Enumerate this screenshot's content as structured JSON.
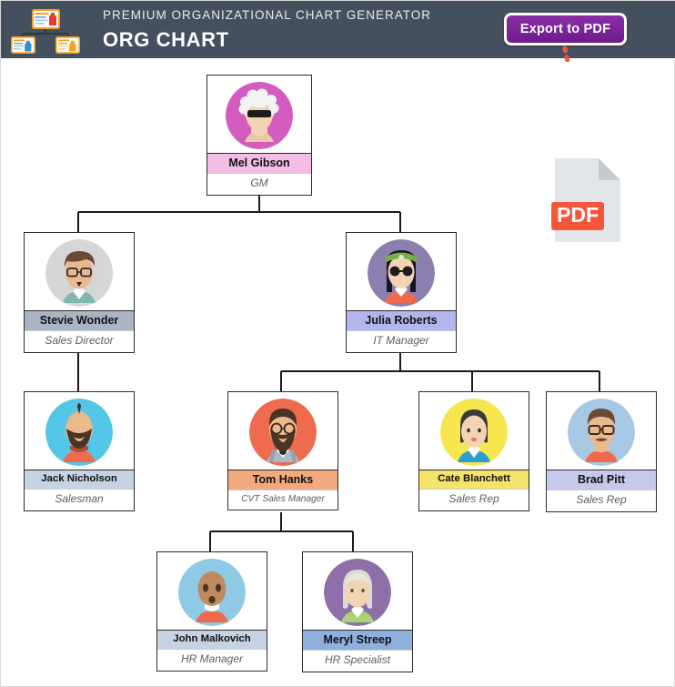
{
  "header": {
    "subtitle": "PREMIUM ORGANIZATIONAL CHART GENERATOR",
    "title": "ORG CHART",
    "export_label": "Export to PDF",
    "background_color": "#44505e",
    "export_button_color": "#7a27a0",
    "logo_icon": "org-chart-logo-icon"
  },
  "pdf": {
    "badge_label": "PDF",
    "badge_color": "#f4563c",
    "arrow_color": "#f4563c",
    "icon": "pdf-document-icon"
  },
  "chart_data": {
    "type": "diagram",
    "title": "ORG CHART",
    "nodes": [
      {
        "id": "mel",
        "name": "Mel Gibson",
        "role": "GM",
        "band_color": "#f3bde4",
        "avatar_bg": "#d45cc0",
        "avatar": "woman-white-curly-hair-sunglasses",
        "level": 0,
        "parent": null
      },
      {
        "id": "stevie",
        "name": "Stevie Wonder",
        "role": "Sales Director",
        "band_color": "#aab4c4",
        "avatar_bg": "#d4d6d8",
        "avatar": "man-brown-hair-glasses",
        "level": 1,
        "parent": "mel"
      },
      {
        "id": "julia",
        "name": "Julia Roberts",
        "role": "IT Manager",
        "band_color": "#b3b6ee",
        "avatar_bg": "#8c7faf",
        "avatar": "woman-black-hair-headband-sunglasses",
        "level": 1,
        "parent": "mel"
      },
      {
        "id": "jack",
        "name": "Jack Nicholson",
        "role": "Salesman",
        "band_color": "#c5d3e2",
        "avatar_bg": "#54c6e8",
        "avatar": "bald-man-beard",
        "level": 2,
        "parent": "stevie"
      },
      {
        "id": "tom",
        "name": "Tom Hanks",
        "role": "CVT Sales Manager",
        "band_color": "#f3a97e",
        "avatar_bg": "#ee6c4d",
        "avatar": "man-beard-glasses-bowtie",
        "level": 2,
        "parent": "julia"
      },
      {
        "id": "cate",
        "name": "Cate Blanchett",
        "role": "Sales Rep",
        "band_color": "#f5e36b",
        "avatar_bg": "#f7e64e",
        "avatar": "woman-black-bob-blue-shirt",
        "level": 2,
        "parent": "julia"
      },
      {
        "id": "brad",
        "name": "Brad Pitt",
        "role": "Sales Rep",
        "band_color": "#c6c9ec",
        "avatar_bg": "#a7c8e5",
        "avatar": "man-moustache-glasses",
        "level": 2,
        "parent": "julia"
      },
      {
        "id": "john",
        "name": "John Malkovich",
        "role": "HR Manager",
        "band_color": "#c5d3e2",
        "avatar_bg": "#8ecae6",
        "avatar": "bald-man-dark-skin",
        "level": 3,
        "parent": "tom"
      },
      {
        "id": "meryl",
        "name": "Meryl Streep",
        "role": "HR Specialist",
        "band_color": "#8fb0de",
        "avatar_bg": "#8e6fa8",
        "avatar": "woman-grey-hair-green-shirt",
        "level": 3,
        "parent": "tom"
      }
    ],
    "edges": [
      {
        "from": "mel",
        "to": "stevie"
      },
      {
        "from": "mel",
        "to": "julia"
      },
      {
        "from": "stevie",
        "to": "jack"
      },
      {
        "from": "julia",
        "to": "tom"
      },
      {
        "from": "julia",
        "to": "cate"
      },
      {
        "from": "julia",
        "to": "brad"
      },
      {
        "from": "tom",
        "to": "john"
      },
      {
        "from": "tom",
        "to": "meryl"
      }
    ],
    "edge_color": "#1a1a1a"
  }
}
